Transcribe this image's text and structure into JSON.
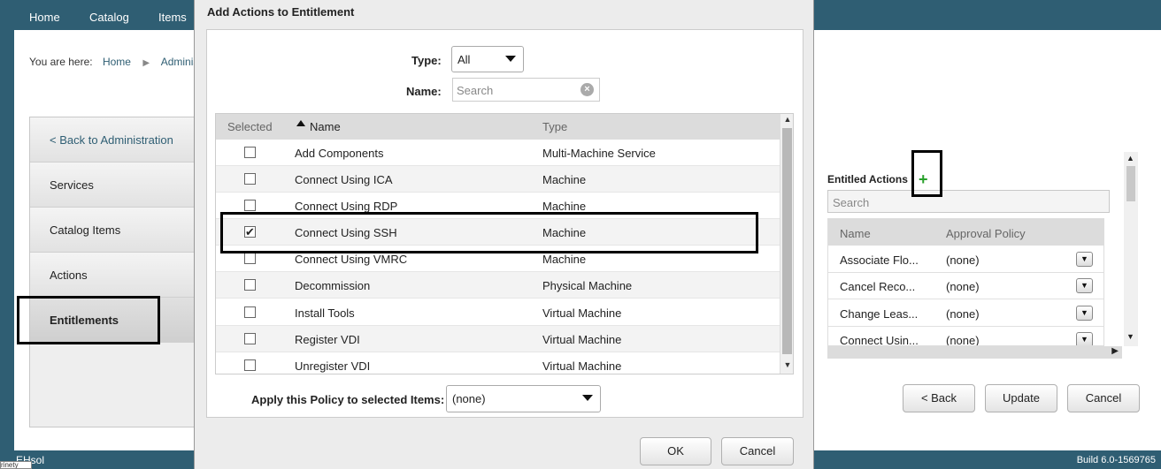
{
  "topnav": {
    "items": [
      "Home",
      "Catalog",
      "Items"
    ]
  },
  "breadcrumb": {
    "prefix": "You are here:",
    "home": "Home",
    "current": "Adminis"
  },
  "leftnav": {
    "back": "< Back to Administration",
    "items": [
      "Services",
      "Catalog Items",
      "Actions",
      "Entitlements"
    ]
  },
  "entitled": {
    "title": "Entitled Actions",
    "search_placeholder": "Search",
    "columns": [
      "Name",
      "Approval Policy"
    ],
    "rows": [
      {
        "name": "Associate Flo...",
        "policy": "(none)"
      },
      {
        "name": "Cancel Reco...",
        "policy": "(none)"
      },
      {
        "name": "Change Leas...",
        "policy": "(none)"
      },
      {
        "name": "Connect Usin...",
        "policy": "(none)"
      }
    ]
  },
  "page_buttons": {
    "back": "< Back",
    "update": "Update",
    "cancel": "Cancel"
  },
  "footer": {
    "left": "EHsol",
    "build": "Build 6.0-1569765",
    "tooltip": "rinety"
  },
  "modal": {
    "title": "Add Actions to Entitlement",
    "type_label": "Type:",
    "type_value": "All",
    "name_label": "Name:",
    "search_placeholder": "Search",
    "columns": {
      "selected": "Selected",
      "name": "Name",
      "type": "Type"
    },
    "rows": [
      {
        "name": "Add Components",
        "type": "Multi-Machine Service",
        "checked": false
      },
      {
        "name": "Connect Using ICA",
        "type": "Machine",
        "checked": false
      },
      {
        "name": "Connect Using RDP",
        "type": "Machine",
        "checked": false
      },
      {
        "name": "Connect Using SSH",
        "type": "Machine",
        "checked": true
      },
      {
        "name": "Connect Using VMRC",
        "type": "Machine",
        "checked": false
      },
      {
        "name": "Decommission",
        "type": "Physical Machine",
        "checked": false
      },
      {
        "name": "Install Tools",
        "type": "Virtual Machine",
        "checked": false
      },
      {
        "name": "Register VDI",
        "type": "Virtual Machine",
        "checked": false
      },
      {
        "name": "Unregister VDI",
        "type": "Virtual Machine",
        "checked": false
      }
    ],
    "policy_label": "Apply this Policy to selected Items:",
    "policy_value": "(none)",
    "ok": "OK",
    "cancel": "Cancel"
  }
}
